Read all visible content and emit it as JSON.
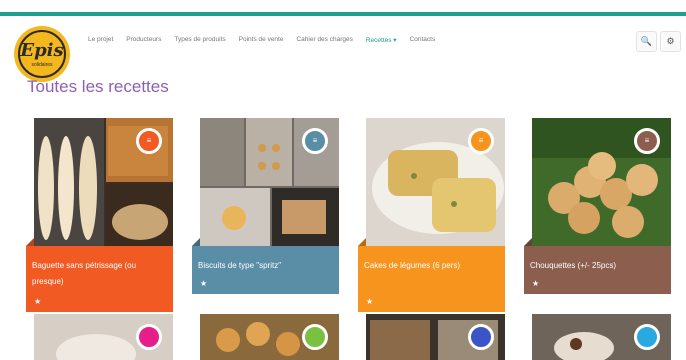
{
  "brand": {
    "logo_text": "Epis",
    "logo_sub": "solidaires"
  },
  "nav": {
    "items": [
      "Le projet",
      "Producteurs",
      "Types de produits",
      "Points de vente",
      "Cahier des charges",
      "Recettes ▾",
      "Contacts"
    ],
    "active_index": 5
  },
  "toolbar": {
    "search_icon": "🔍",
    "settings_icon": "⚙"
  },
  "page": {
    "title": "Toutes les recettes"
  },
  "cards": [
    {
      "label": "Baguette sans pétrissage (ou presque)",
      "star": "★",
      "badge_icon": "≡",
      "color": "#f15a22"
    },
    {
      "label": "Biscuits de type \"spritz\"",
      "star": "★",
      "badge_icon": "≡",
      "color": "#5a8ea6"
    },
    {
      "label": "Cakes de légumes (6 pers)",
      "star": "★",
      "badge_icon": "≡",
      "color": "#f7941d"
    },
    {
      "label": "Chouquettes (+/- 25pcs)",
      "star": "★",
      "badge_icon": "≡",
      "color": "#8c5e4e"
    }
  ],
  "cards_row2": [
    {
      "badge_color": "#e61e8c"
    },
    {
      "badge_color": "#7ac142"
    },
    {
      "badge_color": "#3a55c8"
    },
    {
      "badge_color": "#29a9e1"
    }
  ]
}
